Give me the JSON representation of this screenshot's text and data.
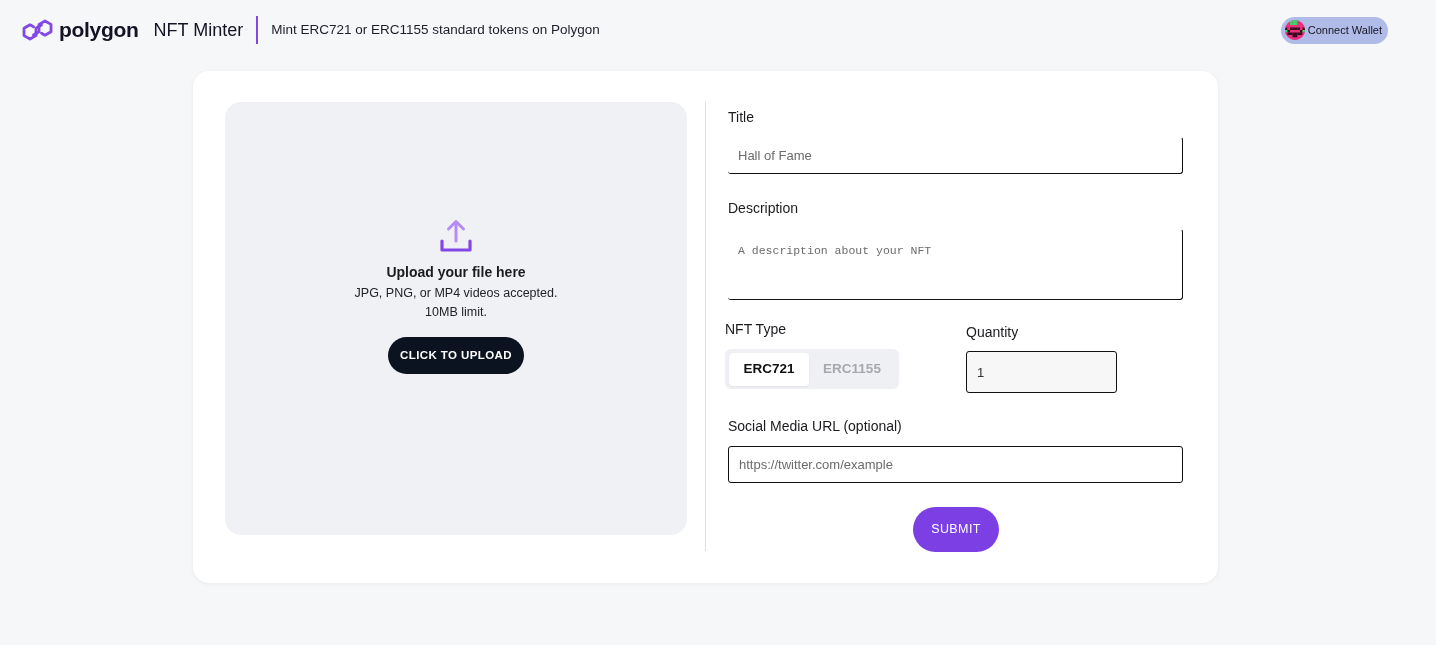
{
  "header": {
    "logo": "polygon",
    "app_name": "NFT Minter",
    "tagline": "Mint ERC721 or ERC1155 standard tokens on Polygon",
    "wallet_button": "Connect Wallet"
  },
  "upload": {
    "title": "Upload your file here",
    "hint_lines": [
      "JPG, PNG, or MP4 videos accepted.",
      "10MB limit."
    ],
    "button": "CLICK TO UPLOAD"
  },
  "form": {
    "title": {
      "label": "Title",
      "placeholder": "Hall of Fame"
    },
    "description": {
      "label": "Description",
      "placeholder": "A description about your NFT"
    },
    "nft_type": {
      "label": "NFT Type",
      "options": [
        {
          "label": "ERC721",
          "selected": true
        },
        {
          "label": "ERC1155",
          "selected": false
        }
      ]
    },
    "quantity": {
      "label": "Quantity",
      "value": "1"
    },
    "social_url": {
      "label": "Social Media URL (optional)",
      "placeholder": "https://twitter.com/example"
    },
    "submit": "SUBMIT"
  }
}
